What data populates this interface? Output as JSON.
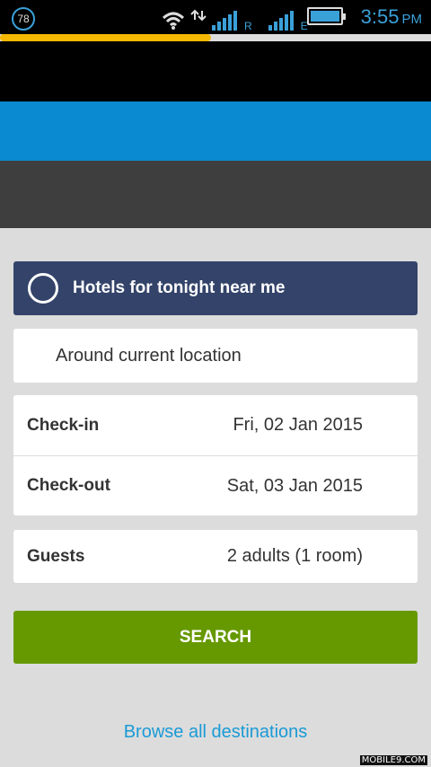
{
  "status_bar": {
    "notification_count": "78",
    "network_r": "R",
    "network_e": "E",
    "time": "3:55",
    "ampm": "PM",
    "icons": [
      "wifi-icon",
      "data-arrows-icon",
      "signal-icon",
      "battery-icon"
    ],
    "accent_color": "#3aa0d8"
  },
  "progress": {
    "fraction": 0.49,
    "color": "#f5b800"
  },
  "tonight": {
    "label": "Hotels for tonight near me"
  },
  "location": {
    "label": "Around current location"
  },
  "dates": {
    "checkin_label": "Check-in",
    "checkin_value": "Fri, 02 Jan 2015",
    "checkout_label": "Check-out",
    "checkout_value": "Sat, 03 Jan 2015"
  },
  "guests": {
    "label": "Guests",
    "value": "2 adults (1 room)"
  },
  "search": {
    "label": "SEARCH",
    "color": "#669900"
  },
  "browse": {
    "label": "Browse all destinations"
  },
  "watermark": "MOBILE9.COM"
}
